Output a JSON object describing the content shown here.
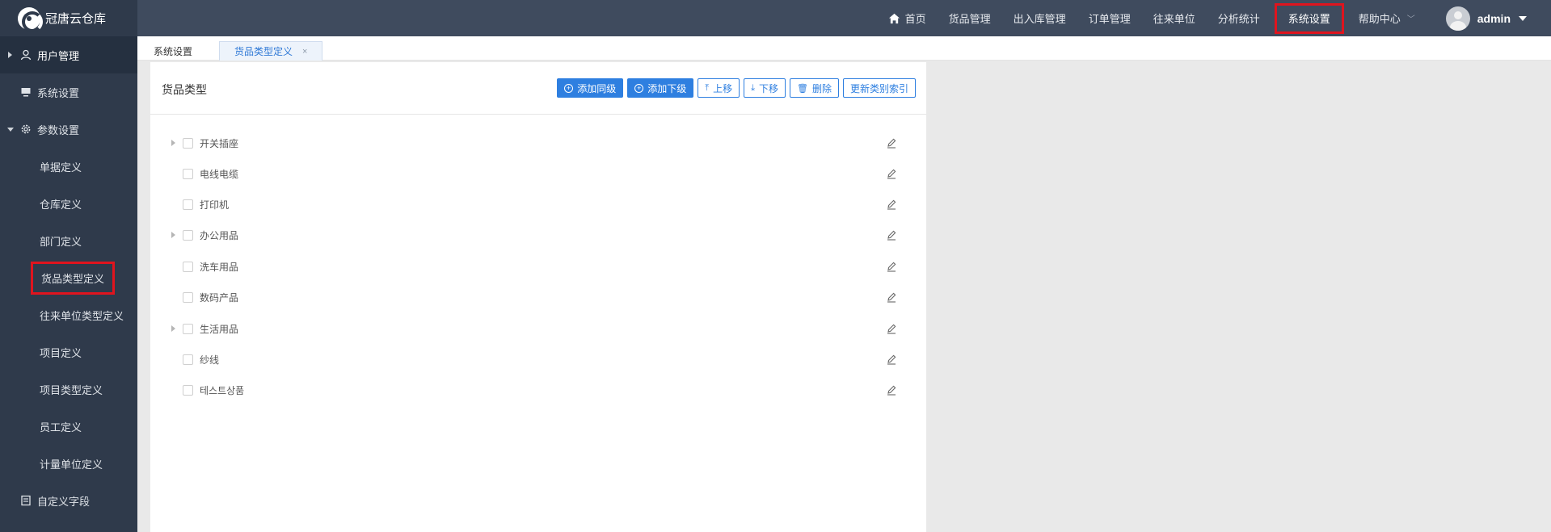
{
  "app": {
    "logo_text": "冠唐云仓库"
  },
  "nav": {
    "items": [
      {
        "label": "首页",
        "icon": "home-icon"
      },
      {
        "label": "货品管理"
      },
      {
        "label": "出入库管理"
      },
      {
        "label": "订单管理"
      },
      {
        "label": "往来单位"
      },
      {
        "label": "分析统计"
      },
      {
        "label": "系统设置",
        "active": true
      },
      {
        "label": "帮助中心",
        "has_dropdown": true
      }
    ],
    "user": {
      "name": "admin"
    }
  },
  "sidebar": {
    "items": [
      {
        "label": "用户管理",
        "icon": "user-icon",
        "level": "top",
        "collapsed": true
      },
      {
        "label": "系统设置",
        "icon": "monitor-icon",
        "level": "top"
      },
      {
        "label": "参数设置",
        "icon": "gear-icon",
        "level": "top",
        "expanded": true
      },
      {
        "label": "单据定义",
        "level": "sub"
      },
      {
        "label": "仓库定义",
        "level": "sub"
      },
      {
        "label": "部门定义",
        "level": "sub"
      },
      {
        "label": "货品类型定义",
        "level": "sub",
        "selected": true
      },
      {
        "label": "往来单位类型定义",
        "level": "sub"
      },
      {
        "label": "项目定义",
        "level": "sub"
      },
      {
        "label": "项目类型定义",
        "level": "sub"
      },
      {
        "label": "员工定义",
        "level": "sub"
      },
      {
        "label": "计量单位定义",
        "level": "sub"
      },
      {
        "label": "自定义字段",
        "icon": "form-icon",
        "level": "top"
      }
    ]
  },
  "tabs": [
    {
      "label": "系统设置"
    },
    {
      "label": "货品类型定义",
      "active": true,
      "close": "×"
    }
  ],
  "panel": {
    "title": "货品类型",
    "buttons": {
      "add_sibling": "添加同级",
      "add_child": "添加下级",
      "move_up": "上移",
      "move_down": "下移",
      "delete": "删除",
      "update_index": "更新类别索引"
    },
    "tree": [
      {
        "label": "开关插座",
        "has_children": true
      },
      {
        "label": "电线电缆",
        "has_children": false
      },
      {
        "label": "打印机",
        "has_children": false
      },
      {
        "label": "办公用品",
        "has_children": true
      },
      {
        "label": "洗车用品",
        "has_children": false
      },
      {
        "label": "数码产品",
        "has_children": false
      },
      {
        "label": "生活用品",
        "has_children": true
      },
      {
        "label": "纱线",
        "has_children": false
      },
      {
        "label": "테스트상품",
        "has_children": false
      }
    ]
  },
  "colors": {
    "topbar": "#3f4b5e",
    "sidebar": "#2f3a4b",
    "accent": "#2e7fe0",
    "highlight": "#e0141e"
  }
}
